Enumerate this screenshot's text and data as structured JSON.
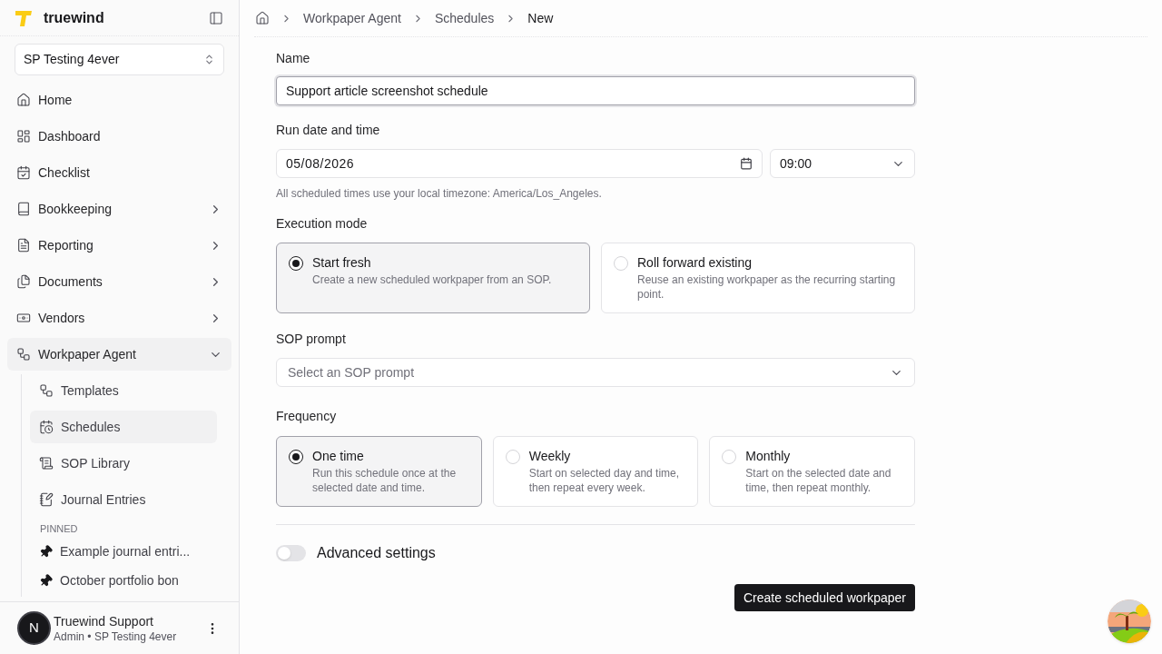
{
  "brand": {
    "name": "truewind"
  },
  "org_select": {
    "value": "SP Testing 4ever"
  },
  "nav": [
    {
      "label": "Home",
      "kind": "link"
    },
    {
      "label": "Dashboard",
      "kind": "link"
    },
    {
      "label": "Checklist",
      "kind": "link"
    },
    {
      "label": "Bookkeeping",
      "kind": "group",
      "expanded": false
    },
    {
      "label": "Reporting",
      "kind": "group",
      "expanded": false
    },
    {
      "label": "Documents",
      "kind": "group",
      "expanded": false
    },
    {
      "label": "Vendors",
      "kind": "group",
      "expanded": false
    },
    {
      "label": "Workpaper Agent",
      "kind": "group",
      "expanded": true,
      "children": [
        {
          "label": "Templates",
          "selected": false
        },
        {
          "label": "Schedules",
          "selected": true
        },
        {
          "label": "SOP Library",
          "selected": false
        },
        {
          "label": "Journal Entries",
          "selected": false
        }
      ]
    }
  ],
  "pinned": {
    "heading": "PINNED",
    "items": [
      {
        "label": "Example journal entri..."
      },
      {
        "label": "October portfolio bon"
      }
    ]
  },
  "user": {
    "initial": "N",
    "name": "Truewind Support",
    "role": "Admin • SP Testing 4ever"
  },
  "breadcrumbs": [
    "Workpaper Agent",
    "Schedules",
    "New"
  ],
  "form": {
    "name": {
      "label": "Name",
      "value": "Support article screenshot schedule"
    },
    "run": {
      "label": "Run date and time",
      "date": "05/08/2026",
      "time": "09:00",
      "hint": "All scheduled times use your local timezone: America/Los_Angeles."
    },
    "execution": {
      "label": "Execution mode",
      "options": [
        {
          "title": "Start fresh",
          "description": "Create a new scheduled workpaper from an SOP.",
          "selected": true
        },
        {
          "title": "Roll forward existing",
          "description": "Reuse an existing workpaper as the recurring starting point.",
          "selected": false
        }
      ]
    },
    "sop": {
      "label": "SOP prompt",
      "placeholder": "Select an SOP prompt"
    },
    "frequency": {
      "label": "Frequency",
      "options": [
        {
          "title": "One time",
          "description": "Run this schedule once at the selected date and time.",
          "selected": true
        },
        {
          "title": "Weekly",
          "description": "Start on selected day and time, then repeat every week.",
          "selected": false
        },
        {
          "title": "Monthly",
          "description": "Start on the selected date and time, then repeat monthly.",
          "selected": false
        }
      ]
    },
    "advanced": {
      "label": "Advanced settings",
      "on": false
    },
    "submit": "Create scheduled workpaper"
  }
}
